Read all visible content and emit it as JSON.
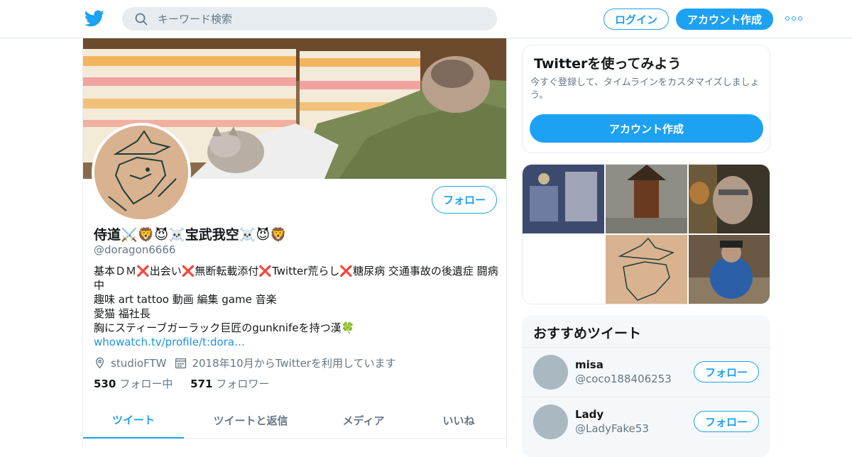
{
  "header": {
    "search_placeholder": "キーワード検索",
    "login_label": "ログイン",
    "signup_label": "アカウント作成",
    "brand_color": "#1da1f2"
  },
  "profile": {
    "name": "侍道⚔️🦁😈☠️宝武我空☠️😈🦁",
    "handle": "@doragon6666",
    "follow_label": "フォロー",
    "bio": {
      "line1_parts": [
        "基本ＤＭ",
        "❌",
        "出会い",
        "❌",
        "無断転載添付",
        "❌",
        "Twitter荒らし",
        "❌",
        "糖尿病 交通事故の後遺症 闘病中"
      ],
      "line2": "趣味 art tattoo 動画 編集 game 音楽",
      "line3": "愛猫 福社長",
      "line4": "胸にスティーブガーラック巨匠のgunknifeを持つ漢🍀",
      "link": "whowatch.tv/profile/t:dora…"
    },
    "location": "studioFTW",
    "joined": "2018年10月からTwitterを利用しています",
    "following_count": "530",
    "following_label": "フォロー中",
    "followers_count": "571",
    "followers_label": "フォロワー"
  },
  "tabs": [
    {
      "label": "ツイート",
      "active": true
    },
    {
      "label": "ツイートと返信",
      "active": false
    },
    {
      "label": "メディア",
      "active": false
    },
    {
      "label": "いいね",
      "active": false
    }
  ],
  "signup_panel": {
    "title": "Twitterを使ってみよう",
    "description": "今すぐ登録して、タイムラインをカスタマイズしましょう。",
    "cta_label": "アカウント作成"
  },
  "recommended": {
    "title": "おすすめツイート",
    "users": [
      {
        "name": "misa",
        "handle": "@coco188406253",
        "follow_label": "フォロー"
      },
      {
        "name": "Lady",
        "handle": "@LadyFake53",
        "follow_label": "フォロー"
      }
    ]
  }
}
